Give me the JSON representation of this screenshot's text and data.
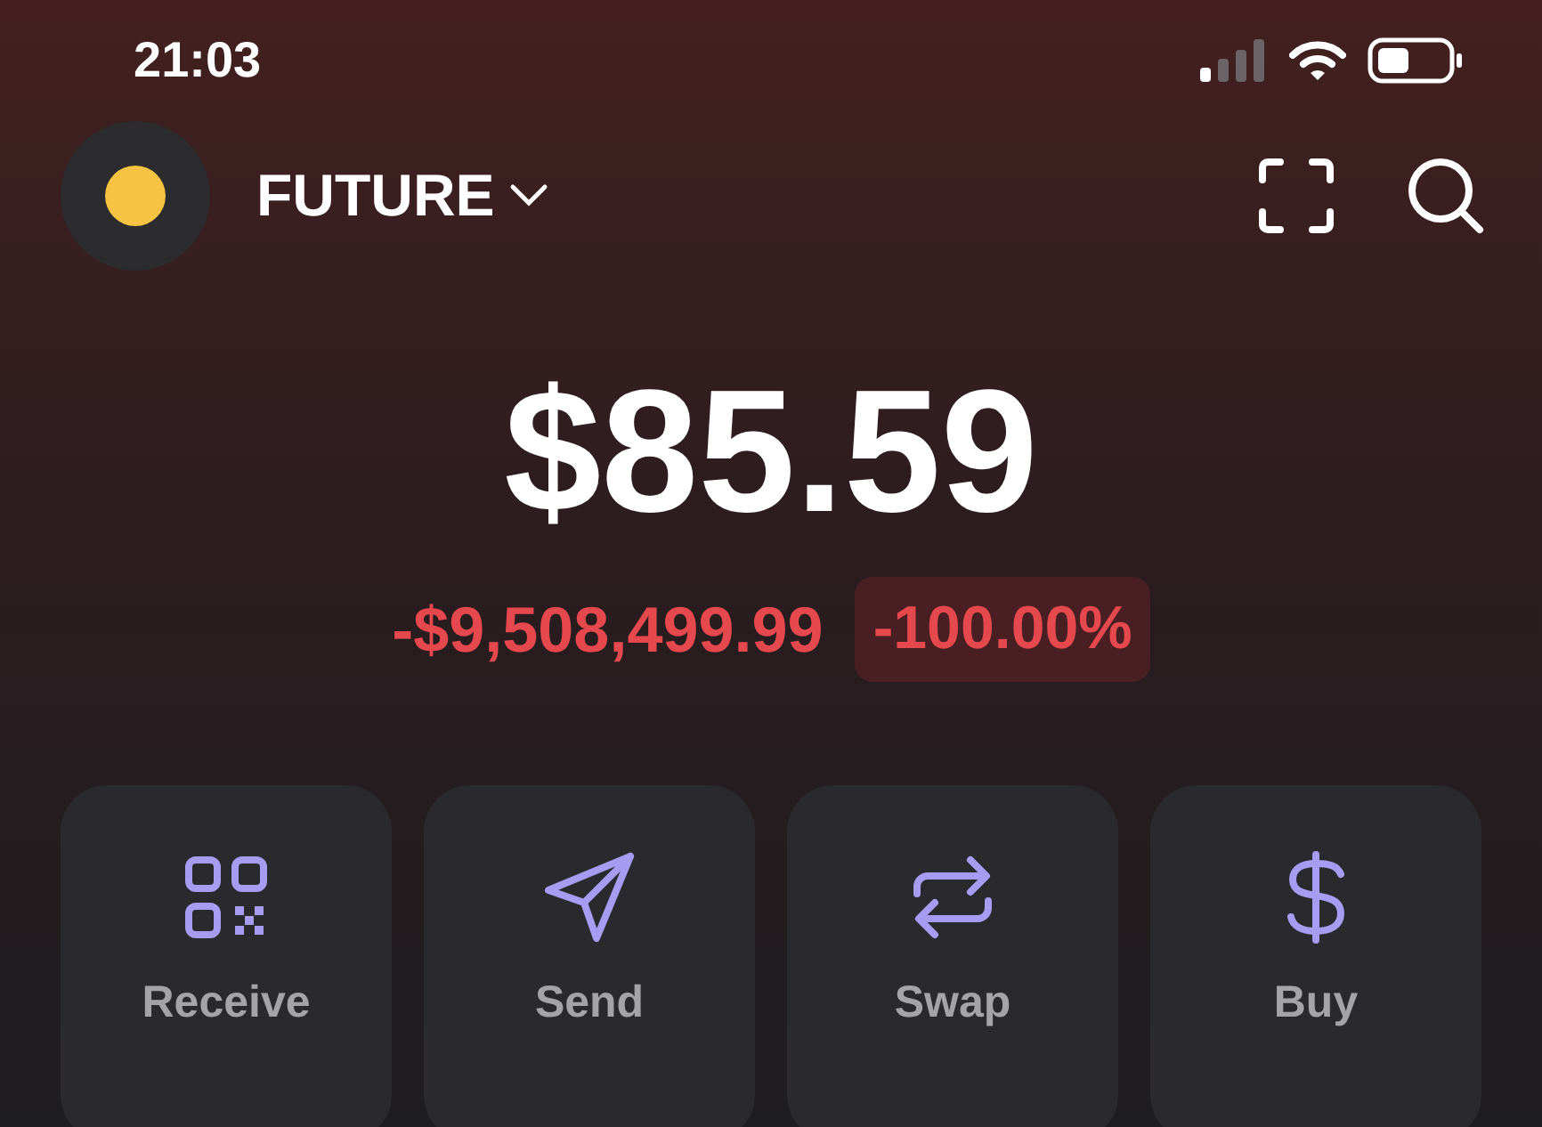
{
  "status_bar": {
    "time": "21:03"
  },
  "account": {
    "name": "FUTURE"
  },
  "balance": {
    "amount": "$85.59",
    "change": "-$9,508,499.99",
    "change_percent": "-100.00%"
  },
  "actions": [
    {
      "label": "Receive",
      "kind": "receive"
    },
    {
      "label": "Send",
      "kind": "send"
    },
    {
      "label": "Swap",
      "kind": "swap"
    },
    {
      "label": "Buy",
      "kind": "buy"
    }
  ]
}
